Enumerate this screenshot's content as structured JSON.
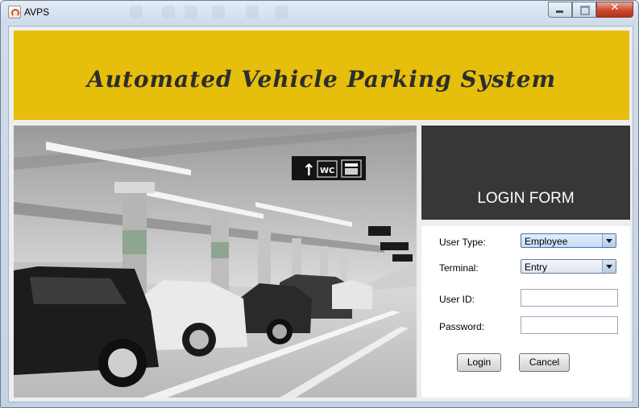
{
  "window": {
    "title": "AVPS",
    "controls": {
      "minimize": "minimize-icon",
      "maximize": "maximize-icon",
      "close": "✕"
    }
  },
  "banner": {
    "title": "Automated Vehicle Parking System",
    "color": "#e6be0c"
  },
  "photo": {
    "description_icons": [
      "up-arrow-sign-icon",
      "wc-sign-icon",
      "elevator-sign-icon"
    ],
    "sign_labels": {
      "arrow": "↑",
      "wc": "WC"
    }
  },
  "login": {
    "header": "LOGIN FORM",
    "user_type_label": "User Type:",
    "user_type_value": "Employee",
    "terminal_label": "Terminal:",
    "terminal_value": "Entry",
    "user_id_label": "User ID:",
    "user_id_value": "",
    "password_label": "Password:",
    "password_value": "",
    "login_button": "Login",
    "cancel_button": "Cancel"
  }
}
